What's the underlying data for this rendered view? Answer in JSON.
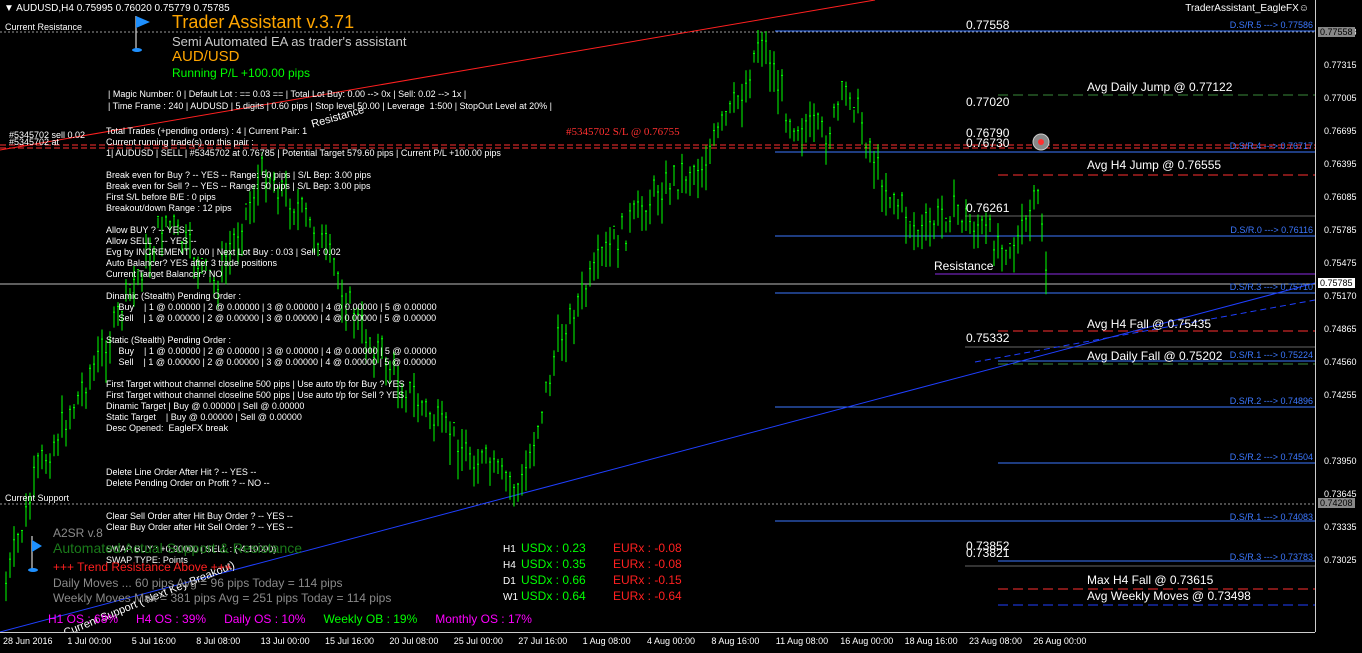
{
  "header": {
    "symbol_line": "AUDUSD,H4  0.75995 0.76020 0.75779 0.75785",
    "ea_name": "TraderAssistant_EagleFX☺"
  },
  "ea": {
    "title": "Trader Assistant v.3.71",
    "subtitle": "Semi Automated EA as trader's assistant",
    "pair": "AUD/USD",
    "pl": "Running P/L +100.00 pips",
    "lines": [
      "| Magic Number: 0 | Default Lot : == 0.03 == | Total Lot Buy: 0.00 --> 0x | Sell: 0.02 --> 1x |",
      "| Time Frame : 240 | AUDUSD | 5 digits | 0.60 pips | Stop level 50.00 | Leverage  1:500 | StopOut Level at 20% |"
    ],
    "status_lines": [
      "Total Trades (+pending orders) : 4 | Current Pair: 1",
      "Current running trade(s) on this pair :",
      "1| AUDUSD | SELL | #5345702 at 0.76785 | Potential Target 579.60 pips | Current P/L +100.00 pips",
      "",
      "Break even for Buy ? -- YES -- Range: 50 pips | S/L Bep: 3.00 pips",
      "Break even for Sell ? -- YES -- Range: 50 pips | S/L Bep: 3.00 pips",
      "First S/L before B/E : 0 pips",
      "Breakout/down Range : 12 pips",
      "",
      "Allow BUY ? -- YES --",
      "Allow SELL ? -- YES --",
      "Evg by INCREMENT 0.00 | Next Lot Buy : 0.03 | Sell : 0.02",
      "Auto Balancer? YES after 3 trade positions",
      "Current Target Balancer? NO",
      "",
      "Dinamic (Stealth) Pending Order :",
      "     Buy    | 1 @ 0.00000 | 2 @ 0.00000 | 3 @ 0.00000 | 4 @ 0.00000 | 5 @ 0.00000",
      "     Sell    | 1 @ 0.00000 | 2 @ 0.00000 | 3 @ 0.00000 | 4 @ 0.00000 | 5 @ 0.00000",
      "",
      "Static (Stealth) Pending Order :",
      "     Buy    | 1 @ 0.00000 | 2 @ 0.00000 | 3 @ 0.00000 | 4 @ 0.00000 | 5 @ 0.00000",
      "     Sell    | 1 @ 0.00000 | 2 @ 0.00000 | 3 @ 0.00000 | 4 @ 0.00000 | 5 @ 0.00000",
      "",
      "First Target without channel closeline 500 pips | Use auto t/p for Buy ? YES",
      "First Target without channel closeline 500 pips | Use auto t/p for Sell ? YES",
      "Dinamic Target | Buy @ 0.00000 | Sell @ 0.00000",
      "Static Target    | Buy @ 0.00000 | Sell @ 0.00000",
      "Desc Opened:  EagleFX break",
      "",
      "",
      "",
      "Delete Line Order After Hit ? -- YES --",
      "Delete Pending Order on Profit ? -- NO --",
      "",
      "",
      "Clear Sell Order after Hit Buy Order ? -- YES --",
      "Clear Buy Order after Hit Sell Order ? -- YES --",
      "",
      "SWAP BUY : +0.90000 | SELL : (-4.10000)",
      "SWAP TYPE: Points"
    ]
  },
  "labels": {
    "current_resistance": "Current Resistance",
    "current_support": "Current Support",
    "resistance_1": "Resistance",
    "resistance_2": "Resistance",
    "sell_order": "#5345702 sell 0.02",
    "sell_order_at": "#5345702 at",
    "sl_label": "#5345702 S/L @ 0.76755",
    "support_breakout": "Current Support ( Next Key Breakout)",
    "a2sr_title": "A2SR v.8",
    "a2sr_sub": "Automated Actual Support & Resistance",
    "trend": "+++  Trend  Resistance Above +++",
    "daily_moves": "Daily Moves  ...  60 pips Avg = 96 pips Today = 114 pips",
    "weekly_moves": "Weekly Moves  Max = 381 pips Avg = 251 pips Today = 114 pips"
  },
  "right_levels": [
    {
      "text": "0.77558"
    },
    {
      "text": "Avg Daily Jump @ 0.77122"
    },
    {
      "text": "0.77020"
    },
    {
      "text": "0.76790"
    },
    {
      "text": "0.76730"
    },
    {
      "text": "Avg H4 Jump @ 0.76555"
    },
    {
      "text": "0.76261"
    },
    {
      "text": "Avg H4 Fall @ 0.75435"
    },
    {
      "text": "0.75332"
    },
    {
      "text": "Avg Daily Fall @ 0.75202"
    },
    {
      "text": "0.73852"
    },
    {
      "text": "0.73821"
    },
    {
      "text": "Max H4 Fall @ 0.73615"
    },
    {
      "text": "Avg Weekly Moves @ 0.73498"
    }
  ],
  "dsr_labels": [
    "D.S/R.5 ---> 0.77586",
    "D.S/R.4 ---> 0.76717",
    "D.S/R.0 ---> 0.76116",
    "D.S/R.3 ---> 0.75710",
    "D.S/R.1 ---> 0.75224",
    "D.S/R.2 ---> 0.74896",
    "D.S/R.2 ---> 0.74504",
    "D.S/R.1 ---> 0.74083",
    "D.S/R.3 ---> 0.73783"
  ],
  "currency_strength": [
    {
      "tf": "H1",
      "usd": "USDx : 0.23",
      "eur": "EURx : -0.08"
    },
    {
      "tf": "H4",
      "usd": "USDx : 0.35",
      "eur": "EURx : -0.08"
    },
    {
      "tf": "D1",
      "usd": "USDx : 0.66",
      "eur": "EURx : -0.15"
    },
    {
      "tf": "W1",
      "usd": "USDx : 0.64",
      "eur": "EURx : -0.64"
    }
  ],
  "os_row": [
    {
      "text": "H1 OS : 68%",
      "color": "#ff00ff"
    },
    {
      "text": "H4 OS : 39%",
      "color": "#ff00ff"
    },
    {
      "text": "Daily OS : 10%",
      "color": "#ff00ff"
    },
    {
      "text": "Weekly OB : 19%",
      "color": "#00ff00"
    },
    {
      "text": "Monthly OS : 17%",
      "color": "#ff00ff"
    }
  ],
  "price_axis": [
    "0.77558",
    "0.77315",
    "0.77005",
    "0.76695",
    "0.76395",
    "0.76085",
    "0.75785",
    "0.75475",
    "0.75170",
    "0.74865",
    "0.74560",
    "0.74255",
    "0.74255",
    "0.73950",
    "0.73645",
    "0.73335",
    "0.73025"
  ],
  "price_axis_current": "0.75785",
  "price_axis_top": "0.77558",
  "price_axis_support": "0.74208",
  "time_axis": [
    "28 Jun 2016",
    "1 Jul 00:00",
    "5 Jul 16:00",
    "8 Jul 08:00",
    "13 Jul 00:00",
    "15 Jul 16:00",
    "20 Jul 08:00",
    "25 Jul 00:00",
    "27 Jul 16:00",
    "1 Aug 08:00",
    "4 Aug 00:00",
    "8 Aug 16:00",
    "11 Aug 08:00",
    "16 Aug 00:00",
    "18 Aug 16:00",
    "23 Aug 08:00",
    "26 Aug 00:00"
  ],
  "colors": {
    "candle": "#00ff00",
    "resistance_line": "#ff0000",
    "support_line": "#1f3fff",
    "dsr_line": "#3c78ff",
    "title": "#ffa500",
    "sub_green": "#00d000"
  }
}
